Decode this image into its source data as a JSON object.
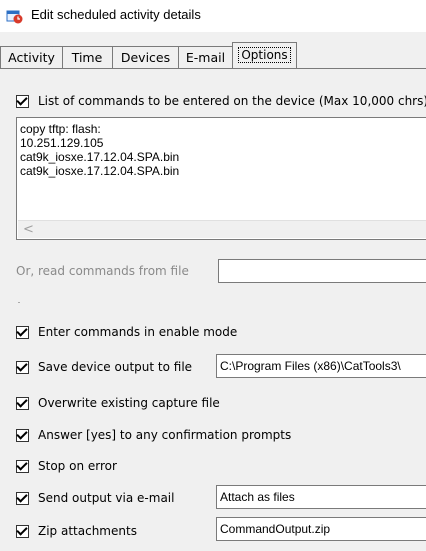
{
  "window": {
    "title": "Edit scheduled activity details"
  },
  "tabs": [
    {
      "label": "Activity"
    },
    {
      "label": "Time"
    },
    {
      "label": "Devices"
    },
    {
      "label": "E-mail"
    },
    {
      "label": "Options"
    }
  ],
  "options": {
    "command_list": {
      "label": "List of commands to be entered on the device (Max 10,000 chrs):",
      "checked": true,
      "lines": [
        "copy tftp: flash:",
        "10.251.129.105",
        "cat9k_iosxe.17.12.04.SPA.bin",
        "cat9k_iosxe.17.12.04.SPA.bin"
      ]
    },
    "read_file": {
      "label": "Or, read commands from file",
      "value": ""
    },
    "enable_mode": {
      "label": "Enter commands in enable mode",
      "checked": true
    },
    "save_output": {
      "label": "Save device output to file",
      "checked": true,
      "value": "C:\\Program Files (x86)\\CatTools3\\"
    },
    "overwrite": {
      "label": "Overwrite existing capture file",
      "checked": true
    },
    "answer_yes": {
      "label": "Answer [yes] to any confirmation prompts",
      "checked": true
    },
    "stop_on_error": {
      "label": "Stop on error",
      "checked": true
    },
    "send_email": {
      "label": "Send output via e-mail",
      "checked": true,
      "value": "Attach as files"
    },
    "zip": {
      "label": "Zip attachments",
      "checked": true,
      "value": "CommandOutput.zip"
    }
  }
}
